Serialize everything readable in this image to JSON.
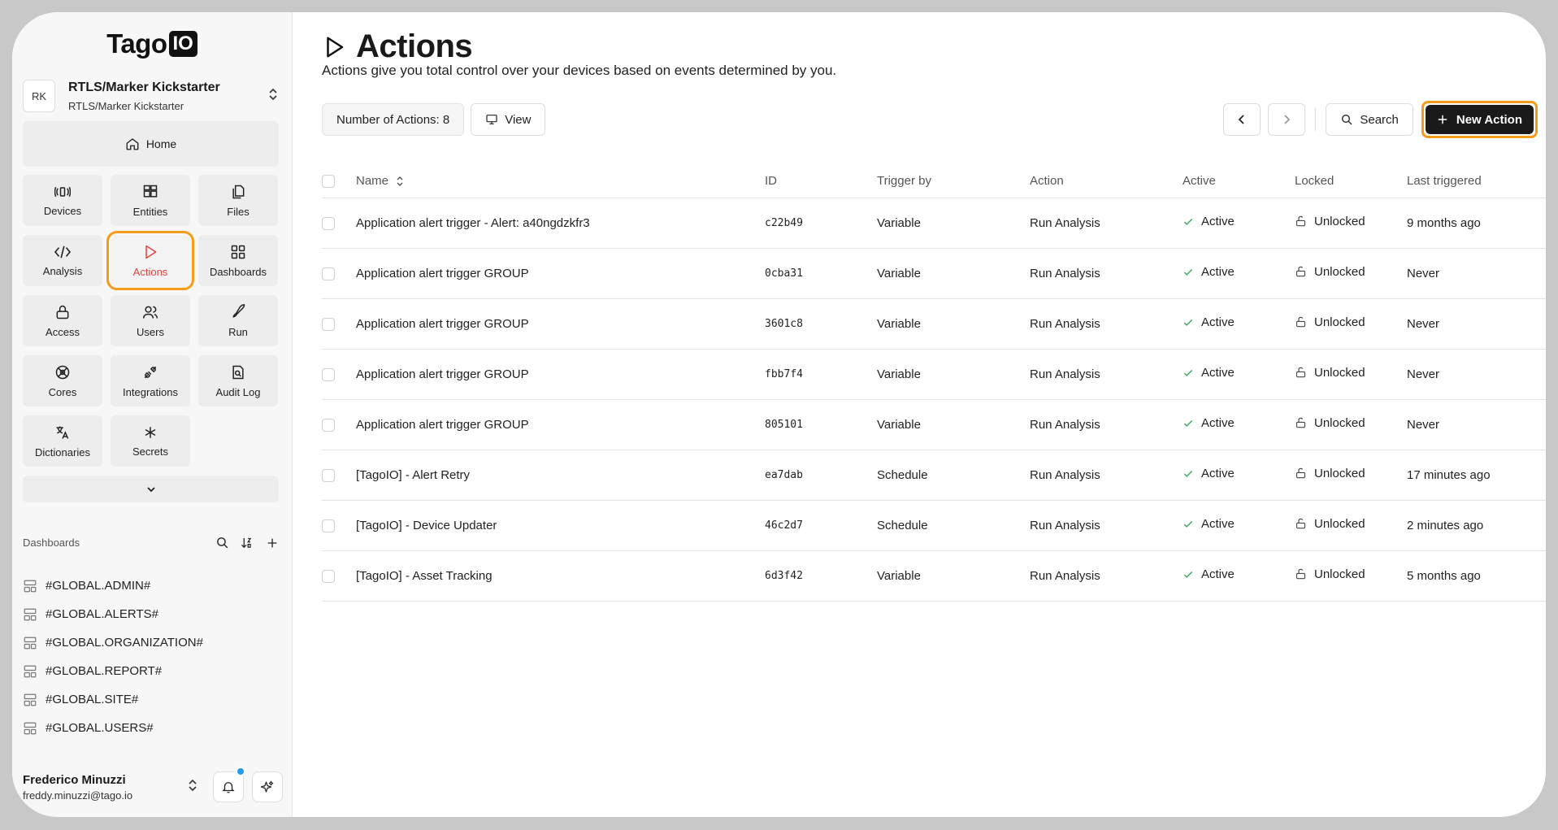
{
  "brand": {
    "name": "Tago",
    "suffix": "IO"
  },
  "org": {
    "initials": "RK",
    "name": "RTLS/Marker Kickstarter",
    "sub": "RTLS/Marker Kickstarter"
  },
  "nav": {
    "home": "Home",
    "items": [
      {
        "label": "Devices",
        "icon": "devices-icon"
      },
      {
        "label": "Entities",
        "icon": "entities-icon"
      },
      {
        "label": "Files",
        "icon": "files-icon"
      },
      {
        "label": "Analysis",
        "icon": "code-icon"
      },
      {
        "label": "Actions",
        "icon": "play-icon",
        "active": true
      },
      {
        "label": "Dashboards",
        "icon": "grid-icon"
      },
      {
        "label": "Access",
        "icon": "lock-icon"
      },
      {
        "label": "Users",
        "icon": "users-icon"
      },
      {
        "label": "Run",
        "icon": "rocket-icon"
      },
      {
        "label": "Cores",
        "icon": "cores-icon"
      },
      {
        "label": "Integrations",
        "icon": "plug-icon"
      },
      {
        "label": "Audit Log",
        "icon": "audit-icon"
      },
      {
        "label": "Dictionaries",
        "icon": "translate-icon"
      },
      {
        "label": "Secrets",
        "icon": "asterisk-icon"
      }
    ]
  },
  "dashboards": {
    "title": "Dashboards",
    "items": [
      "#GLOBAL.ADMIN#",
      "#GLOBAL.ALERTS#",
      "#GLOBAL.ORGANIZATION#",
      "#GLOBAL.REPORT#",
      "#GLOBAL.SITE#",
      "#GLOBAL.USERS#"
    ]
  },
  "user": {
    "name": "Frederico Minuzzi",
    "email": "freddy.minuzzi@tago.io"
  },
  "page": {
    "title": "Actions",
    "description": "Actions give you total control over your devices based on events determined by you."
  },
  "toolbar": {
    "count_label": "Number of Actions: 8",
    "view_label": "View",
    "search_label": "Search",
    "new_label": "New Action"
  },
  "table": {
    "headers": {
      "name": "Name",
      "id": "ID",
      "trigger": "Trigger by",
      "action": "Action",
      "active": "Active",
      "locked": "Locked",
      "last": "Last triggered"
    },
    "rows": [
      {
        "name": "Application alert trigger - Alert: a40ngdzkfr3",
        "id": "c22b49",
        "trigger": "Variable",
        "action": "Run Analysis",
        "active": "Active",
        "locked": "Unlocked",
        "last": "9 months ago"
      },
      {
        "name": "Application alert trigger GROUP",
        "id": "0cba31",
        "trigger": "Variable",
        "action": "Run Analysis",
        "active": "Active",
        "locked": "Unlocked",
        "last": "Never"
      },
      {
        "name": "Application alert trigger GROUP",
        "id": "3601c8",
        "trigger": "Variable",
        "action": "Run Analysis",
        "active": "Active",
        "locked": "Unlocked",
        "last": "Never"
      },
      {
        "name": "Application alert trigger GROUP",
        "id": "fbb7f4",
        "trigger": "Variable",
        "action": "Run Analysis",
        "active": "Active",
        "locked": "Unlocked",
        "last": "Never"
      },
      {
        "name": "Application alert trigger GROUP",
        "id": "805101",
        "trigger": "Variable",
        "action": "Run Analysis",
        "active": "Active",
        "locked": "Unlocked",
        "last": "Never"
      },
      {
        "name": "[TagoIO] - Alert Retry",
        "id": "ea7dab",
        "trigger": "Schedule",
        "action": "Run Analysis",
        "active": "Active",
        "locked": "Unlocked",
        "last": "17 minutes ago"
      },
      {
        "name": "[TagoIO] - Device Updater",
        "id": "46c2d7",
        "trigger": "Schedule",
        "action": "Run Analysis",
        "active": "Active",
        "locked": "Unlocked",
        "last": "2 minutes ago"
      },
      {
        "name": "[TagoIO] - Asset Tracking",
        "id": "6d3f42",
        "trigger": "Variable",
        "action": "Run Analysis",
        "active": "Active",
        "locked": "Unlocked",
        "last": "5 months ago"
      }
    ]
  },
  "colors": {
    "accent_highlight": "#f59b1a",
    "active_red": "#e0443e",
    "check_green": "#3aa55c",
    "dark_button": "#1a1a1a",
    "notify_dot": "#1e9be9"
  }
}
